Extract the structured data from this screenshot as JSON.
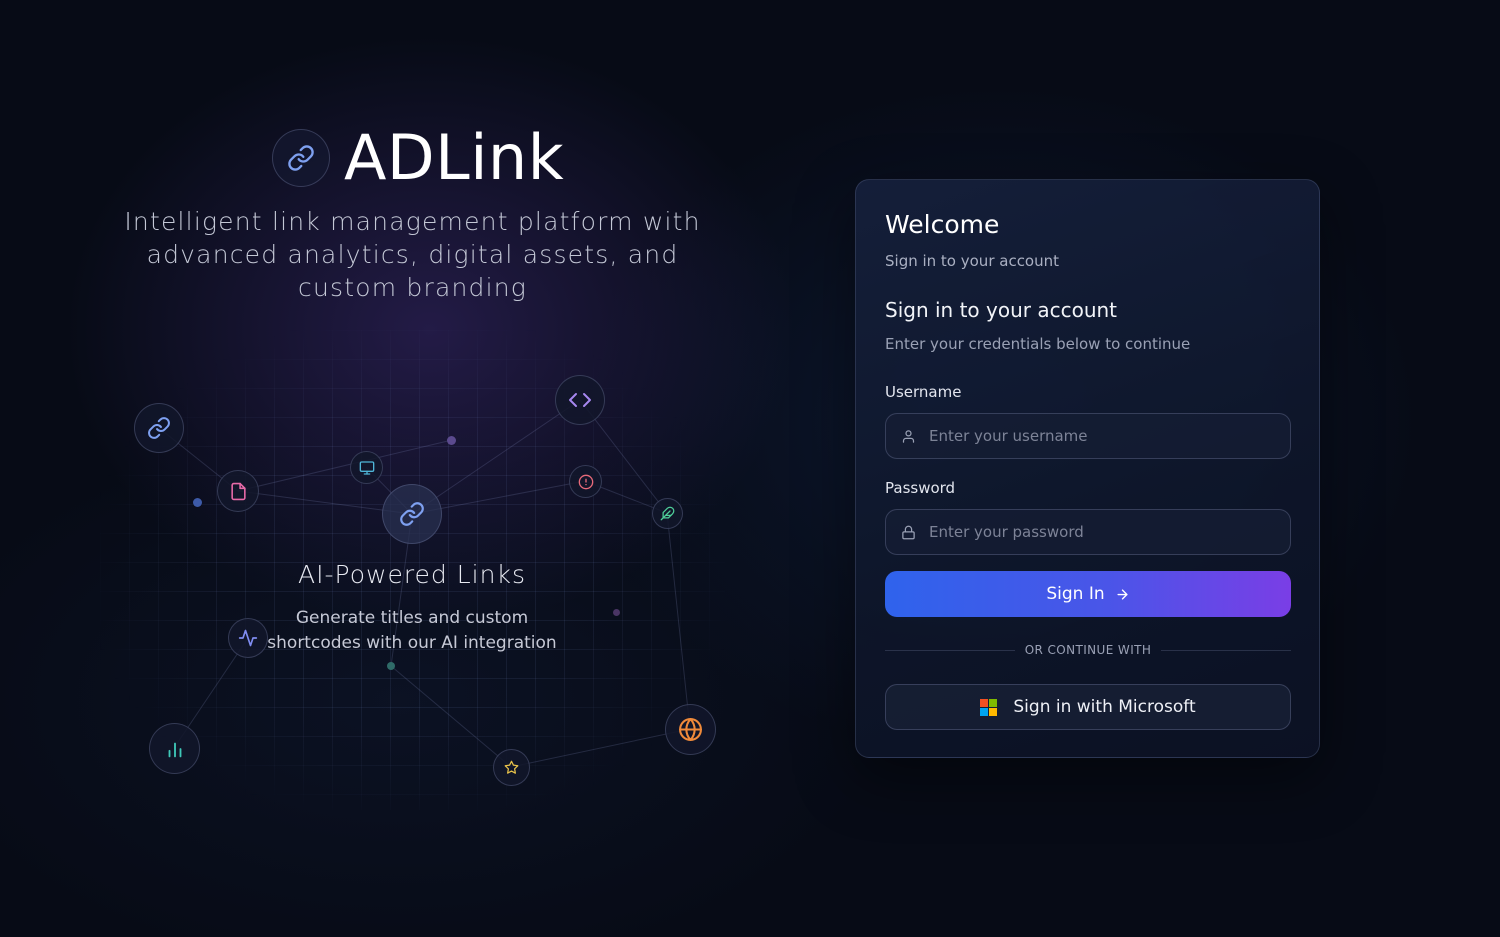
{
  "brand": {
    "title": "ADLink",
    "tagline": "Intelligent link management platform with advanced analytics, digital assets, and custom branding"
  },
  "feature": {
    "title": "AI-Powered Links",
    "description": "Generate titles and custom shortcodes with our AI integration"
  },
  "nodes": [
    {
      "name": "link-node-icon",
      "icon": "link-icon",
      "color": "#6f8fe8"
    },
    {
      "name": "code-node-icon",
      "icon": "code-icon",
      "color": "#a787f0"
    },
    {
      "name": "file-node-icon",
      "icon": "file-icon",
      "color": "#e76aa8"
    },
    {
      "name": "monitor-node-icon",
      "icon": "monitor-icon",
      "color": "#4fb6d8"
    },
    {
      "name": "central-link-node-icon",
      "icon": "link-icon",
      "color": "#6f8fe8"
    },
    {
      "name": "alert-node-icon",
      "icon": "alert-icon",
      "color": "#e86a7a"
    },
    {
      "name": "feather-node-icon",
      "icon": "feather-icon",
      "color": "#4fcf9a"
    },
    {
      "name": "activity-node-icon",
      "icon": "activity-icon",
      "color": "#7f8cf0"
    },
    {
      "name": "chart-node-icon",
      "icon": "bar-chart-icon",
      "color": "#3fc8b8"
    },
    {
      "name": "star-node-icon",
      "icon": "star-icon",
      "color": "#e8c24a"
    },
    {
      "name": "globe-node-icon",
      "icon": "globe-icon",
      "color": "#f08a3a"
    }
  ],
  "login": {
    "welcome": "Welcome",
    "welcome_sub": "Sign in to your account",
    "form_title": "Sign in to your account",
    "form_sub": "Enter your credentials below to continue",
    "username_label": "Username",
    "username_placeholder": "Enter your username",
    "username_value": "",
    "password_label": "Password",
    "password_placeholder": "Enter your password",
    "password_value": "",
    "signin_label": "Sign In",
    "divider": "OR CONTINUE WITH",
    "microsoft_label": "Sign in with Microsoft"
  },
  "colors": {
    "background": "#070b16",
    "button_gradient_start": "#2f63ec",
    "button_gradient_end": "#7a3ee6",
    "microsoft": [
      "#f25022",
      "#7fba00",
      "#00a4ef",
      "#ffb900"
    ]
  }
}
